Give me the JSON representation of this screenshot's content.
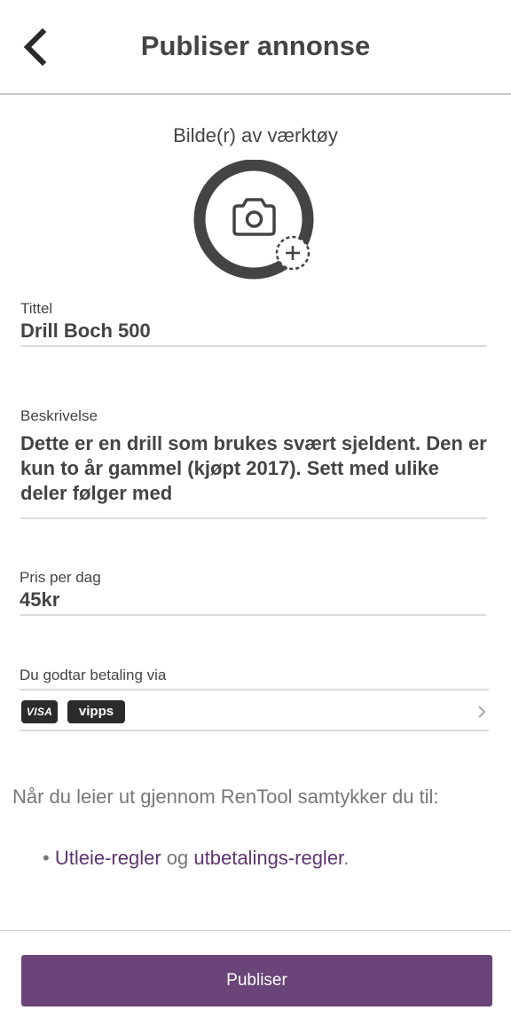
{
  "header": {
    "title": "Publiser annonse",
    "back_icon": "chevron-left-icon"
  },
  "image_picker": {
    "label": "Bilde(r) av værktøy",
    "icon": "camera-icon",
    "add_icon": "plus-icon"
  },
  "fields": {
    "title": {
      "label": "Tittel",
      "value": "Drill Boch 500"
    },
    "description": {
      "label": "Beskrivelse",
      "value": "Dette er en drill som brukes svært sjeldent. Den er kun to år gammel (kjøpt 2017). Sett med ulike deler følger med"
    },
    "price": {
      "label": "Pris per dag",
      "value": "45kr"
    }
  },
  "payment": {
    "label": "Du godtar betaling via",
    "methods": [
      "VISA",
      "vipps"
    ],
    "chevron_icon": "chevron-right-icon"
  },
  "consent": {
    "text": "Når du leier ut gjennom RenTool samtykker du til:",
    "bullet": "•",
    "link1": "Utleie-regler",
    "middle": "og",
    "link2": "utbetalings-regler",
    "end": "."
  },
  "footer": {
    "publish_label": "Publiser"
  },
  "colors": {
    "accent": "#6b457a",
    "link": "#5e3570",
    "text": "#444444",
    "muted": "#777777"
  }
}
